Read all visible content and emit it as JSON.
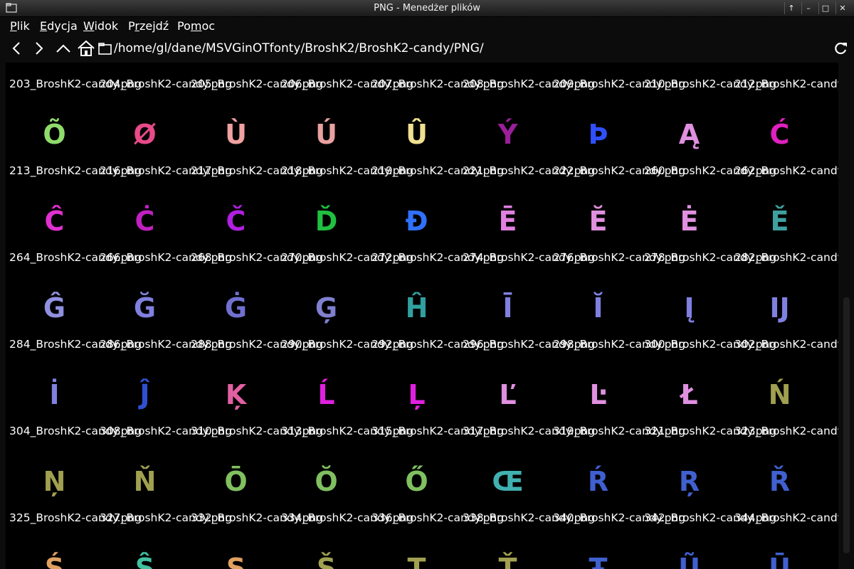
{
  "window": {
    "title": "PNG - Menedżer plików",
    "controls": [
      "↑",
      "–",
      "□",
      "✕"
    ]
  },
  "menu": [
    "Plik",
    "Edycja",
    "Widok",
    "Przejdź",
    "Pomoc"
  ],
  "menu_access": [
    "P",
    "E",
    "W",
    "r",
    "m"
  ],
  "location": {
    "path": "/home/gl/dane/MSVGinOTfonty/BroshK2/BroshK2-candy/PNG/"
  },
  "files": {
    "row0": [
      "203_BroshK2-candy.png",
      "204_BroshK2-candy.png",
      "205_BroshK2-candy.png",
      "206_BroshK2-candy.png",
      "207_BroshK2-candy.png",
      "208_BroshK2-candy.png",
      "209_BroshK2-candy.png",
      "210_BroshK2-candy.png",
      "212_BroshK2-candy.png"
    ],
    "row1": [
      "213_BroshK2-candy.png",
      "216_BroshK2-candy.png",
      "217_BroshK2-candy.png",
      "218_BroshK2-candy.png",
      "219_BroshK2-candy.png",
      "221_BroshK2-candy.png",
      "222_BroshK2-candy.png",
      "260_BroshK2-candy.png",
      "262_BroshK2-candy.png"
    ],
    "row2": [
      "264_BroshK2-candy.png",
      "266_BroshK2-candy.png",
      "268_BroshK2-candy.png",
      "270_BroshK2-candy.png",
      "272_BroshK2-candy.png",
      "274_BroshK2-candy.png",
      "276_BroshK2-candy.png",
      "278_BroshK2-candy.png",
      "282_BroshK2-candy.png"
    ],
    "row3": [
      "284_BroshK2-candy.png",
      "286_BroshK2-candy.png",
      "288_BroshK2-candy.png",
      "290_BroshK2-candy.png",
      "292_BroshK2-candy.png",
      "296_BroshK2-candy.png",
      "298_BroshK2-candy.png",
      "300_BroshK2-candy.png",
      "302_BroshK2-candy.png"
    ],
    "row4": [
      "304_BroshK2-candy.png",
      "308_BroshK2-candy.png",
      "310_BroshK2-candy.png",
      "313_BroshK2-candy.png",
      "315_BroshK2-candy.png",
      "317_BroshK2-candy.png",
      "319_BroshK2-candy.png",
      "321_BroshK2-candy.png",
      "323_BroshK2-candy.png"
    ],
    "row5": [
      "325_BroshK2-candy.png",
      "327_BroshK2-candy.png",
      "332_BroshK2-candy.png",
      "334_BroshK2-candy.png",
      "336_BroshK2-candy.png",
      "338_BroshK2-candy.png",
      "340_BroshK2-candy.png",
      "342_BroshK2-candy.png",
      "344_BroshK2-candy.png"
    ]
  },
  "thumbnails": {
    "row0": [
      {
        "glyph": "Õ",
        "color": "#8fdc6a"
      },
      {
        "glyph": "Ø",
        "color": "#e94a8a"
      },
      {
        "glyph": "Ù",
        "color": "#f0a0a0"
      },
      {
        "glyph": "Ú",
        "color": "#e8a0a0"
      },
      {
        "glyph": "Û",
        "color": "#f0e090"
      },
      {
        "glyph": "Ý",
        "color": "#9a1f9a"
      },
      {
        "glyph": "Þ",
        "color": "#3050ff"
      },
      {
        "glyph": "Ą",
        "color": "#e090e0"
      },
      {
        "glyph": "Ć",
        "color": "#e020c0"
      }
    ],
    "row1": [
      {
        "glyph": "Ĉ",
        "color": "#e030d0"
      },
      {
        "glyph": "Ċ",
        "color": "#c020c0"
      },
      {
        "glyph": "Č",
        "color": "#b020e0"
      },
      {
        "glyph": "Ď",
        "color": "#20c040"
      },
      {
        "glyph": "Đ",
        "color": "#3070ff"
      },
      {
        "glyph": "Ē",
        "color": "#e080e0"
      },
      {
        "glyph": "Ĕ",
        "color": "#e090e0"
      },
      {
        "glyph": "Ė",
        "color": "#e090e0"
      },
      {
        "glyph": "Ě",
        "color": "#40a0a0"
      }
    ],
    "row2": [
      {
        "glyph": "Ĝ",
        "color": "#9090e0"
      },
      {
        "glyph": "Ğ",
        "color": "#8080e0"
      },
      {
        "glyph": "Ġ",
        "color": "#7070d0"
      },
      {
        "glyph": "Ģ",
        "color": "#8080d0"
      },
      {
        "glyph": "Ĥ",
        "color": "#30a0a0"
      },
      {
        "glyph": "Ī",
        "color": "#8080e0"
      },
      {
        "glyph": "Ĭ",
        "color": "#8080e0"
      },
      {
        "glyph": "Į",
        "color": "#8080e0"
      },
      {
        "glyph": "Ĳ",
        "color": "#8080e0"
      }
    ],
    "row3": [
      {
        "glyph": "İ",
        "color": "#8080e0"
      },
      {
        "glyph": "Ĵ",
        "color": "#3050d0"
      },
      {
        "glyph": "Ķ",
        "color": "#e060a0"
      },
      {
        "glyph": "Ĺ",
        "color": "#e020e0"
      },
      {
        "glyph": "Ļ",
        "color": "#e020e0"
      },
      {
        "glyph": "Ľ",
        "color": "#e090e0"
      },
      {
        "glyph": "Ŀ",
        "color": "#e090e0"
      },
      {
        "glyph": "Ł",
        "color": "#e090e0"
      },
      {
        "glyph": "Ń",
        "color": "#a0a050"
      }
    ],
    "row4": [
      {
        "glyph": "Ņ",
        "color": "#a0a050"
      },
      {
        "glyph": "Ň",
        "color": "#a0a050"
      },
      {
        "glyph": "Ō",
        "color": "#80c060"
      },
      {
        "glyph": "Ŏ",
        "color": "#80c060"
      },
      {
        "glyph": "Ő",
        "color": "#80c060"
      },
      {
        "glyph": "Œ",
        "color": "#40b0b0"
      },
      {
        "glyph": "Ŕ",
        "color": "#4060d0"
      },
      {
        "glyph": "Ŗ",
        "color": "#4060d0"
      },
      {
        "glyph": "Ř",
        "color": "#4060d0"
      }
    ],
    "row5": [
      {
        "glyph": "Ś",
        "color": "#e0a060"
      },
      {
        "glyph": "Ŝ",
        "color": "#40c0a0"
      },
      {
        "glyph": "Ş",
        "color": "#e0a060"
      },
      {
        "glyph": "Š",
        "color": "#a0a050"
      },
      {
        "glyph": "Ţ",
        "color": "#a0a050"
      },
      {
        "glyph": "Ť",
        "color": "#a0a050"
      },
      {
        "glyph": "Ŧ",
        "color": "#4060d0"
      },
      {
        "glyph": "Ũ",
        "color": "#4060d0"
      },
      {
        "glyph": "Ū",
        "color": "#4060d0"
      }
    ]
  }
}
